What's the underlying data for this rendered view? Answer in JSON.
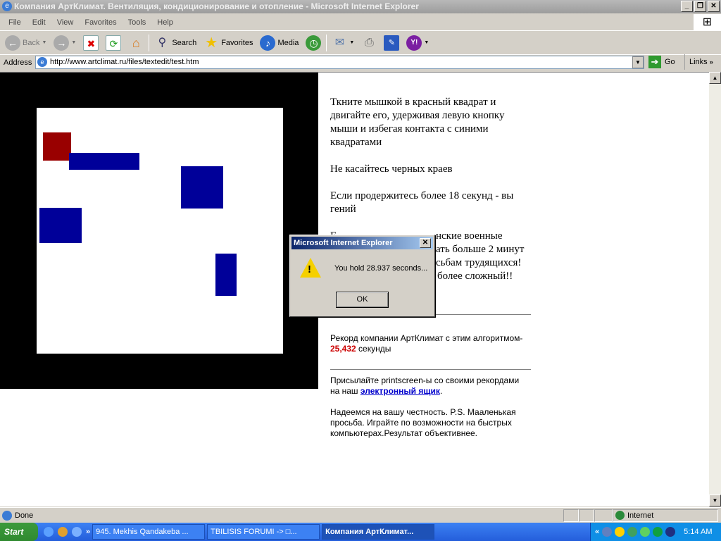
{
  "window": {
    "title": "Компания АртКлимат. Вентиляция, кондиционирование и отопление - Microsoft Internet Explorer",
    "minimize": "_",
    "restore": "❐",
    "close": "✕"
  },
  "menu": [
    "File",
    "Edit",
    "View",
    "Favorites",
    "Tools",
    "Help"
  ],
  "toolbar": {
    "back": "Back",
    "search": "Search",
    "favorites": "Favorites",
    "media": "Media"
  },
  "address": {
    "label": "Address",
    "url": "http://www.artclimat.ru/files/textedit/test.htm",
    "go": "Go",
    "links": "Links"
  },
  "page": {
    "instructions": [
      "Ткните мышкой в красный квадрат и",
      "двигайте его, удерживая левую кнопку",
      "мыши и избегая контакта с синими",
      "квадратами"
    ],
    "rule": "Не касайтесь черных краев",
    "genius": [
      "Если продержитесь более 18 секунд - вы",
      "гений"
    ],
    "partial": {
      "l1a": "Е",
      "l1b": "нские военные",
      "l2": "ать больше 2 минут",
      "l3": "сьбам трудящихся!",
      "l4": "более сложный!!"
    },
    "record_text": "Рекорд компании АртКлимат с этим алгоритмом-",
    "record_value": "25,432",
    "record_unit": " секунды",
    "send_text": "Присылайте printscreen-ы со своими рекордами",
    "send_text2": "на наш ",
    "send_link": "электронный ящик",
    "send_dot": ".",
    "honesty": [
      "Надеемся на вашу честность. P.S. Мааленькая",
      "просьба. Играйте по возможности на быстрых",
      "компьютерах.Результат объективнее."
    ]
  },
  "dialog": {
    "title": "Microsoft Internet Explorer",
    "message": "You hold 28.937 seconds...",
    "ok": "OK"
  },
  "status": {
    "text": "Done",
    "zone": "Internet"
  },
  "taskbar": {
    "start": "Start",
    "tasks": [
      "945. Mekhis Qandakeba ...",
      "TBILISIS FORUMI -> □...",
      "Компания АртКлимат..."
    ],
    "clock": "5:14 AM"
  },
  "colors": {
    "red_square": "#990000",
    "blue_square": "#000099",
    "record": "#cc0000",
    "link": "#0000cc"
  }
}
